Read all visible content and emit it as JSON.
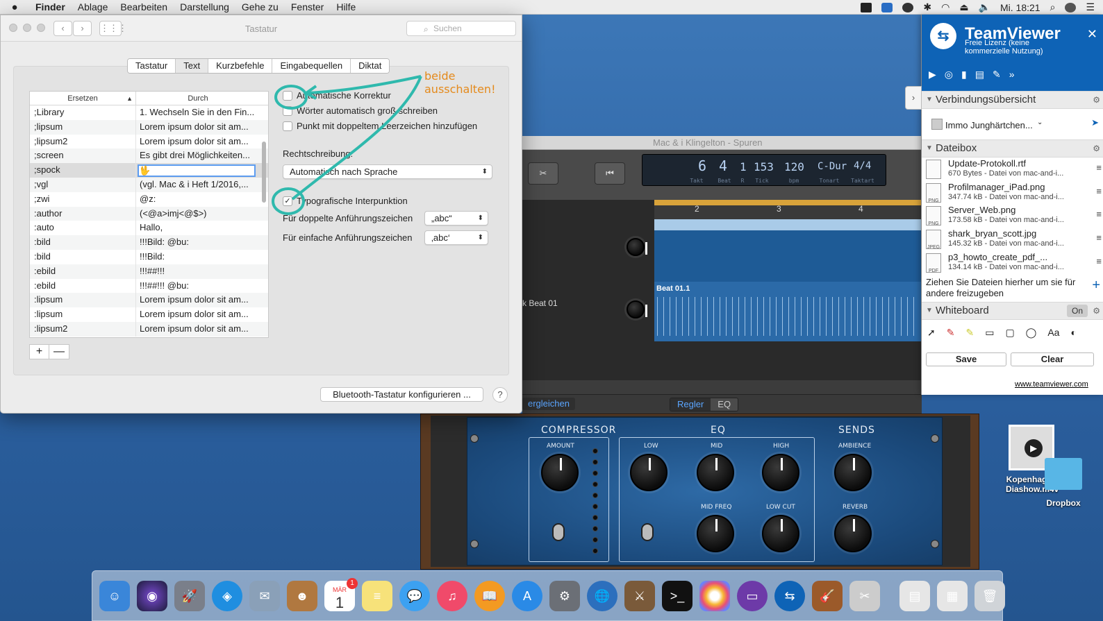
{
  "menubar": {
    "apple": "",
    "items": [
      "Finder",
      "Ablage",
      "Bearbeiten",
      "Darstellung",
      "Gehe zu",
      "Fenster",
      "Hilfe"
    ],
    "clock": "Mi. 18:21"
  },
  "prefs": {
    "window_title": "Tastatur",
    "search_placeholder": "Suchen",
    "tabs": [
      "Tastatur",
      "Text",
      "Kurzbefehle",
      "Eingabequellen",
      "Diktat"
    ],
    "selected_tab": "Text",
    "table": {
      "col_replace": "Ersetzen",
      "col_with": "Durch",
      "rows": [
        [
          ";Library",
          "1. Wechseln Sie in den Fin..."
        ],
        [
          ";lipsum",
          "Lorem ipsum dolor sit am..."
        ],
        [
          ";lipsum2",
          "Lorem ipsum dolor sit am..."
        ],
        [
          ";screen",
          "Es gibt drei Möglichkeiten..."
        ],
        [
          ";spock",
          "🖖"
        ],
        [
          ";vgl",
          "(vgl. Mac & i Heft 1/2016,..."
        ],
        [
          ";zwi",
          "@z:"
        ],
        [
          ":author",
          "(<@a>imj<@$>)"
        ],
        [
          ":auto",
          "Hallo,"
        ],
        [
          ":bild",
          "!!!Bild:   @bu:"
        ],
        [
          ":bild",
          "!!!Bild:"
        ],
        [
          ":ebild",
          "!!!##!!!"
        ],
        [
          ":ebild",
          "!!!##!!! @bu:"
        ],
        [
          ":lipsum",
          "Lorem ipsum dolor sit am..."
        ],
        [
          ":lipsum",
          "Lorem ipsum dolor sit am..."
        ],
        [
          ":lipsum2",
          "Lorem ipsum dolor sit am..."
        ]
      ]
    },
    "plus": "+",
    "minus": "—",
    "options": {
      "autocorrect": "Automatische Korrektur",
      "capitalize": "Wörter automatisch groß schreiben",
      "period": "Punkt mit doppeltem Leerzeichen hinzufügen",
      "spelling_label": "Rechtschreibung:",
      "spelling_value": "Automatisch nach Sprache",
      "smart_quotes": "Typografische Interpunktion",
      "double_label": "Für doppelte Anführungszeichen",
      "double_value": "„abc“",
      "single_label": "Für einfache Anführungszeichen",
      "single_value": "‚abc‘"
    },
    "checked": {
      "autocorrect": false,
      "capitalize": false,
      "period": false,
      "smart_quotes": true
    },
    "bt_button": "Bluetooth-Tastatur konfigurieren ...",
    "help": "?",
    "annotation": "beide ausschalten!"
  },
  "garageband": {
    "title": "Mac & i Klingelton - Spuren",
    "lcd": {
      "bar": "6",
      "beat": "4",
      "r": "1",
      "tick": "153",
      "bpm": "120",
      "key": "C-Dur",
      "sig": "4/4",
      "sub_bar": "Takt",
      "sub_beat": "Beat",
      "sub_r": "R",
      "sub_tick": "Tick",
      "sub_bpm": "bpm",
      "sub_key": "Tonart",
      "sub_sig": "Taktart"
    },
    "ruler": [
      "2",
      "3",
      "4"
    ],
    "region_name": "Beat 01.1",
    "track_label": "k Beat 01",
    "bottom": {
      "compare": "ergleichen",
      "regler": "Regler",
      "eq": "EQ"
    }
  },
  "plugin": {
    "sections": {
      "compressor": "COMPRESSOR",
      "eq": "EQ",
      "sends": "SENDS"
    },
    "knobs": {
      "amount": "AMOUNT",
      "low": "LOW",
      "mid": "MID",
      "high": "HIGH",
      "mid_freq": "MID FREQ",
      "low_cut": "LOW CUT",
      "ambience": "AMBIENCE",
      "reverb": "REVERB"
    }
  },
  "teamviewer": {
    "title": "TeamViewer",
    "subtitle": "Freie Lizenz (keine kommerzielle Nutzung)",
    "close": "✕",
    "sec_connections": "Verbindungsübersicht",
    "partner": "Immo Junghärtchen...",
    "sec_files": "Dateibox",
    "files": [
      {
        "name": "Update-Protokoll.rtf",
        "meta": "670 Bytes - Datei von mac-and-i...",
        "type": ""
      },
      {
        "name": "Profilmanager_iPad.png",
        "meta": "347.74 kB - Datei von mac-and-i...",
        "type": "PNG"
      },
      {
        "name": "Server_Web.png",
        "meta": "173.58 kB - Datei von mac-and-i...",
        "type": "PNG"
      },
      {
        "name": "shark_bryan_scott.jpg",
        "meta": "145.32 kB - Datei von mac-and-i...",
        "type": "JPEG"
      },
      {
        "name": "p3_howto_create_pdf_...",
        "meta": "134.14 kB - Datei von mac-and-i...",
        "type": "PDF"
      }
    ],
    "drop_hint": "Ziehen Sie Dateien hierher um sie für andere freizugeben",
    "sec_whiteboard": "Whiteboard",
    "wb_state": "On",
    "save": "Save",
    "clear": "Clear",
    "link": "www.teamviewer.com"
  },
  "desktop": {
    "file_name": "Kopenhagen Diashow.m4v",
    "dropbox": "Dropbox"
  },
  "dock": {
    "calendar_month": "MÄR",
    "calendar_day": "1",
    "calendar_badge": "1"
  }
}
